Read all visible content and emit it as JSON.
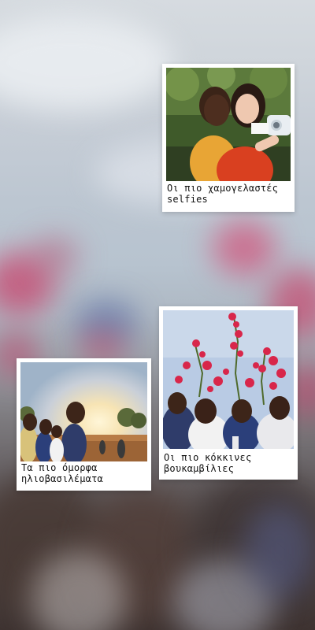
{
  "cards": [
    {
      "caption": "Οι πιο χαμογελαστές\nselfies"
    },
    {
      "caption": "Οι πιο κόκκινες\nβουκαμβίλιες"
    },
    {
      "caption": "Τα πιο όμορφα\nηλιοβασιλέματα"
    }
  ]
}
